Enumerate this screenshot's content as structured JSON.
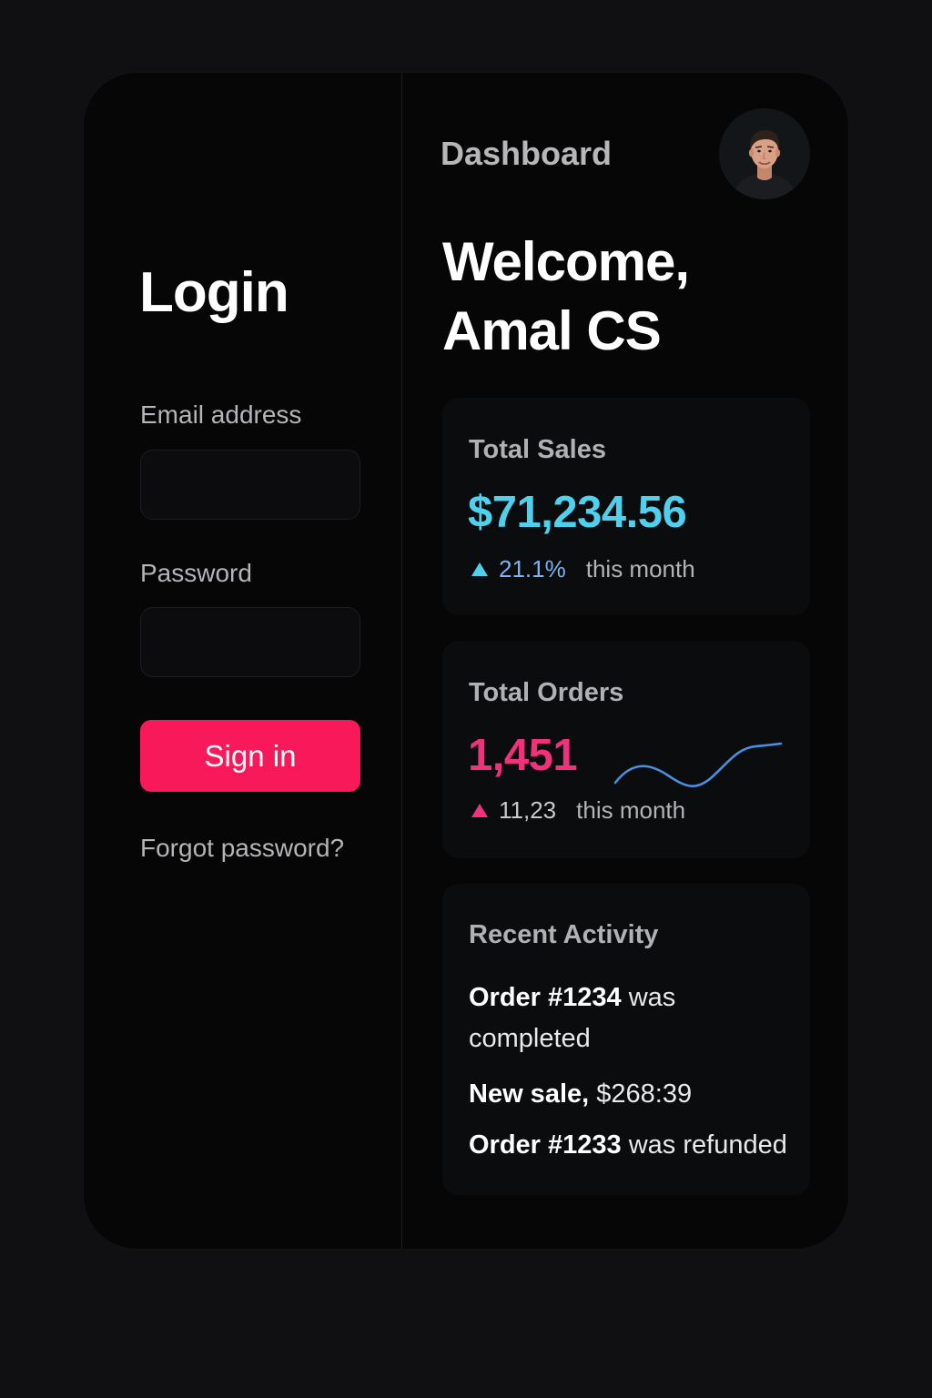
{
  "login": {
    "title": "Login",
    "email_label": "Email address",
    "email_value": "",
    "password_label": "Password",
    "password_value": "",
    "signin_label": "Sign in",
    "forgot_label": "Forgot password?"
  },
  "dashboard": {
    "title": "Dashboard",
    "welcome_line1": "Welcome,",
    "welcome_line2": "Amal CS",
    "avatar_icon": "user-avatar-photo"
  },
  "sales": {
    "title": "Total Sales",
    "value": "$71,234.56",
    "change": "21.1%",
    "period": "this month",
    "value_color": "#4fd1ee",
    "change_color": "#7db3ee",
    "trend_icon": "triangle-up-icon"
  },
  "orders": {
    "title": "Total Orders",
    "value": "1,451",
    "change": "11,23",
    "period": "this month",
    "value_color": "#f0317b",
    "line_color": "#4a8fe0",
    "trend_icon": "triangle-up-icon"
  },
  "activity": {
    "title": "Recent Activity",
    "items": [
      {
        "bold": "Order #1234",
        "rest": " was completed"
      },
      {
        "bold": "New sale,",
        "rest": " $268:39"
      },
      {
        "bold": "Order #1233",
        "rest": " was refunded"
      }
    ]
  },
  "colors": {
    "accent": "#f7195a",
    "background": "#101012",
    "panel": "#060607",
    "card": "#0b0c0e"
  }
}
